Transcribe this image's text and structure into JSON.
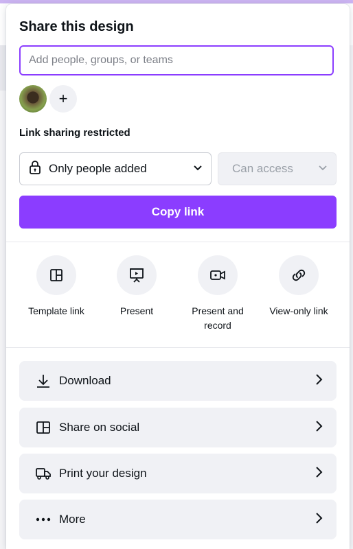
{
  "dialog": {
    "title": "Share this design",
    "search_placeholder": "Add people, groups, or teams",
    "add_person_label": "+"
  },
  "link_sharing": {
    "label": "Link sharing restricted",
    "audience": "Only people added",
    "access": "Can access",
    "copy_link": "Copy link"
  },
  "quick_actions": [
    {
      "label": "Template link",
      "icon": "template-icon"
    },
    {
      "label": "Present",
      "icon": "present-icon"
    },
    {
      "label": "Present and\nrecord",
      "icon": "record-icon"
    },
    {
      "label": "View-only link",
      "icon": "link-icon"
    }
  ],
  "options": [
    {
      "label": "Download",
      "icon": "download-icon"
    },
    {
      "label": "Share on social",
      "icon": "social-icon"
    },
    {
      "label": "Print your design",
      "icon": "print-icon"
    },
    {
      "label": "More",
      "icon": "more-icon"
    }
  ],
  "colors": {
    "accent": "#8b3dff",
    "button_bg": "#f0f1f5"
  }
}
